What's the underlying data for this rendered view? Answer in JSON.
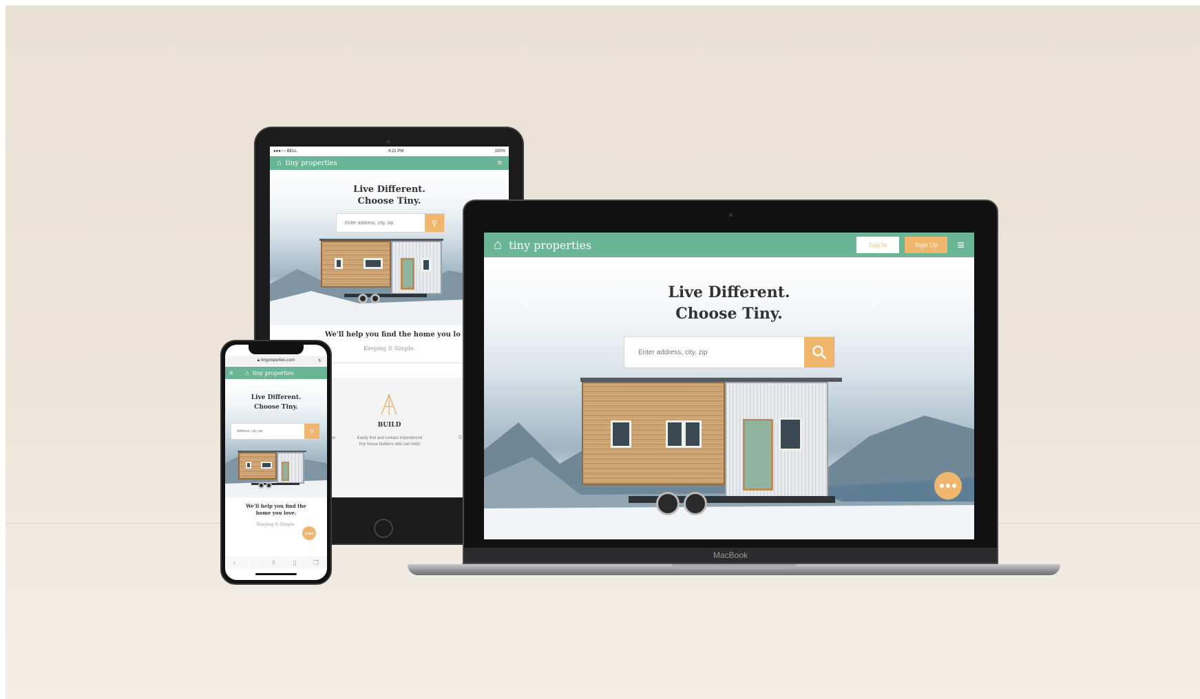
{
  "brand": {
    "name": "tiny properties"
  },
  "colors": {
    "primary": "#6bb597",
    "accent": "#f1b66d",
    "text": "#333333"
  },
  "hero": {
    "line1": "Live Different.",
    "line2": "Choose Tiny."
  },
  "laptop": {
    "login_label": "Log In",
    "signup_label": "Sign Up",
    "search_placeholder": "Enter address, city, zip",
    "device_label": "MacBook"
  },
  "tablet": {
    "status_carrier": "●●●○○ BELL",
    "status_time": "4:21 PM",
    "status_battery": "100%",
    "search_placeholder": "Enter address, city, zip",
    "tagline": "We'll help you find the home you lo",
    "subtag": "Keeping It Simple.",
    "feature_left_text": "omes for\nworld.",
    "feature_title": "BUILD",
    "feature_text": "Easily find and contact experienced tiny house builders who can help!",
    "feature_right_text": "Q"
  },
  "phone": {
    "url": "tinyproperties.com",
    "search_placeholder": "Address, city, zip",
    "tagline_line1": "We'll help you find the",
    "tagline_line2": "home you love.",
    "subtag": "Keeping It Simple."
  }
}
